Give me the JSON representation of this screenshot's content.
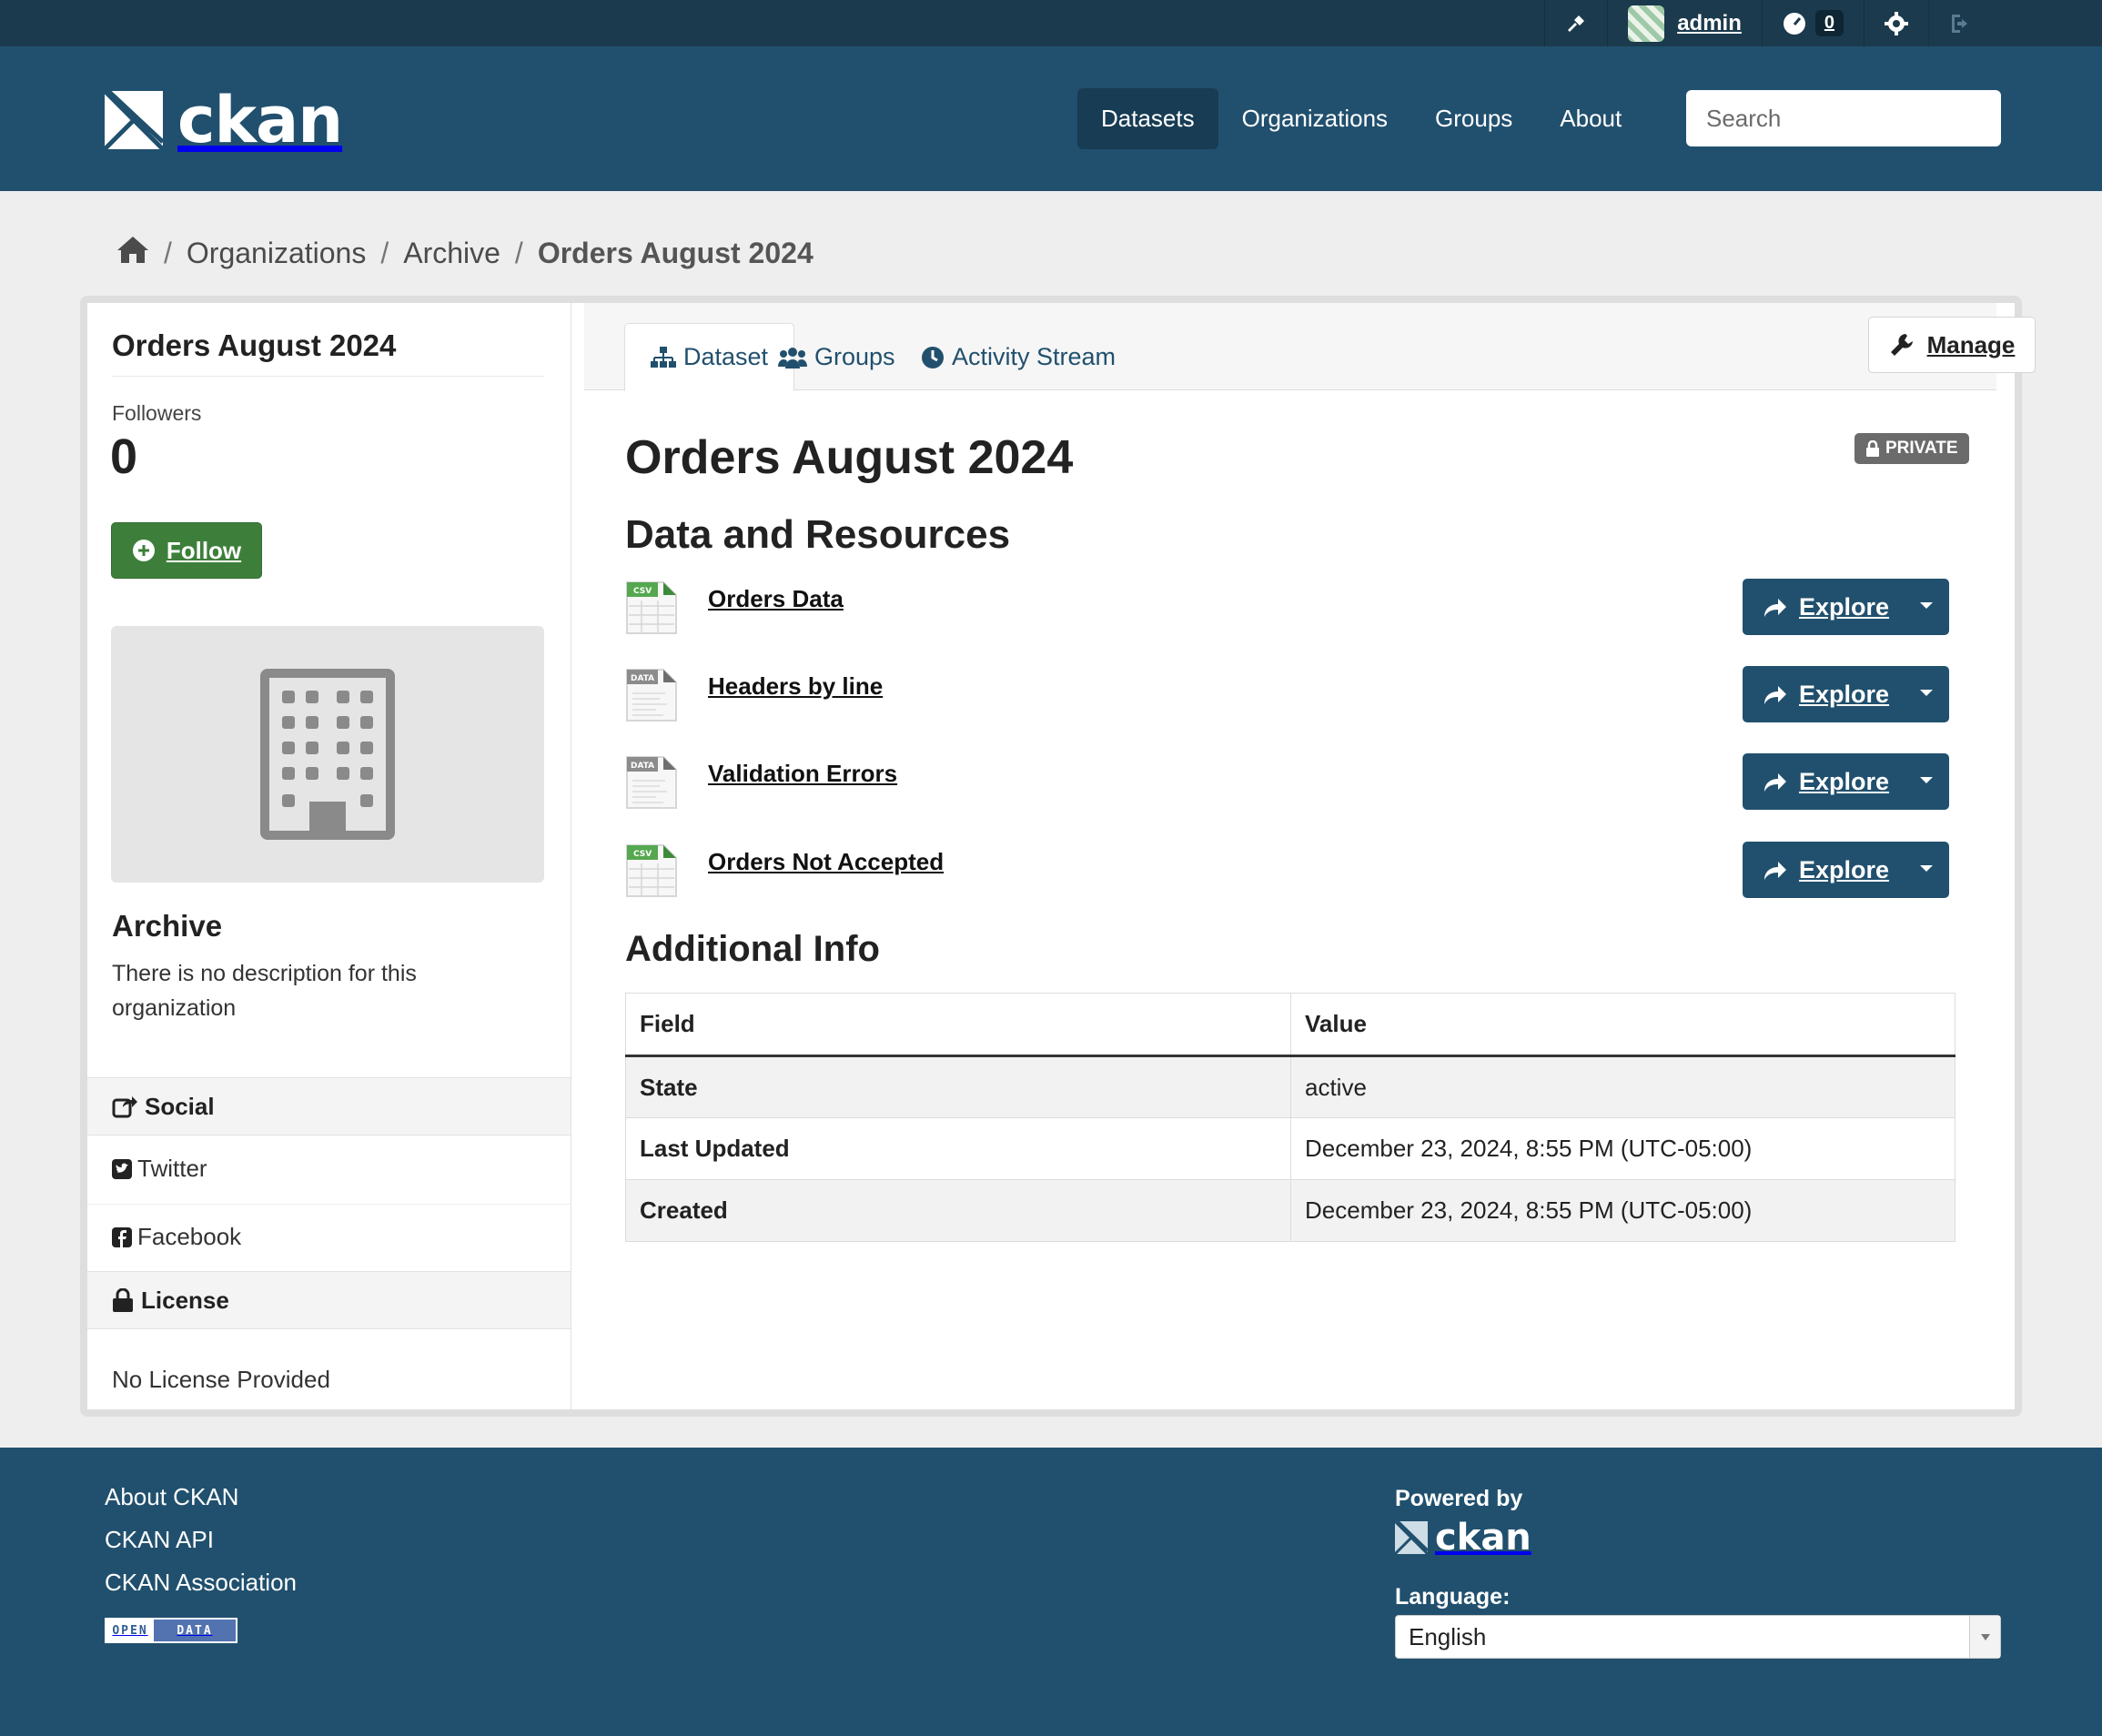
{
  "account": {
    "username": "admin",
    "notification_count": "0"
  },
  "masthead": {
    "logo_text": "ckan",
    "nav": [
      {
        "label": "Datasets",
        "active": true
      },
      {
        "label": "Organizations",
        "active": false
      },
      {
        "label": "Groups",
        "active": false
      },
      {
        "label": "About",
        "active": false
      }
    ],
    "search_placeholder": "Search"
  },
  "breadcrumb": {
    "items": [
      "Organizations",
      "Archive"
    ],
    "current": "Orders August 2024"
  },
  "sidebar": {
    "title": "Orders August 2024",
    "followers_label": "Followers",
    "followers_count": "0",
    "follow_label": "Follow",
    "org_name": "Archive",
    "org_description": "There is no description for this organization",
    "social_heading": "Social",
    "social_links": [
      "Twitter",
      "Facebook"
    ],
    "license_heading": "License",
    "license_text": "No License Provided"
  },
  "tabs": [
    {
      "label": "Dataset",
      "icon": "sitemap-icon",
      "active": true
    },
    {
      "label": "Groups",
      "icon": "users-icon",
      "active": false
    },
    {
      "label": "Activity Stream",
      "icon": "clock-icon",
      "active": false
    }
  ],
  "manage_label": "Manage",
  "dataset": {
    "title": "Orders August 2024",
    "private_label": "PRIVATE",
    "resources_heading": "Data and Resources",
    "resources": [
      {
        "name": "Orders Data",
        "format": "CSV"
      },
      {
        "name": "Headers by line",
        "format": "DATA"
      },
      {
        "name": "Validation Errors",
        "format": "DATA"
      },
      {
        "name": "Orders Not Accepted",
        "format": "CSV"
      }
    ],
    "explore_label": "Explore",
    "additional_info_heading": "Additional Info",
    "info_table": {
      "headers": [
        "Field",
        "Value"
      ],
      "rows": [
        {
          "field": "State",
          "value": "active"
        },
        {
          "field": "Last Updated",
          "value": "December 23, 2024, 8:55 PM (UTC-05:00)"
        },
        {
          "field": "Created",
          "value": "December 23, 2024, 8:55 PM (UTC-05:00)"
        }
      ]
    }
  },
  "footer": {
    "links": [
      "About CKAN",
      "CKAN API",
      "CKAN Association"
    ],
    "opendata_badge": [
      "OPEN",
      "DATA"
    ],
    "powered_by": "Powered by",
    "powered_logo": "ckan",
    "language_label": "Language:",
    "language_selected": "English"
  },
  "colors": {
    "masthead": "#21506e",
    "account_bar": "#1b3a4d",
    "follow_green": "#3d7f3a",
    "explore_blue": "#21506e",
    "private_gray": "#6b6b6b"
  }
}
